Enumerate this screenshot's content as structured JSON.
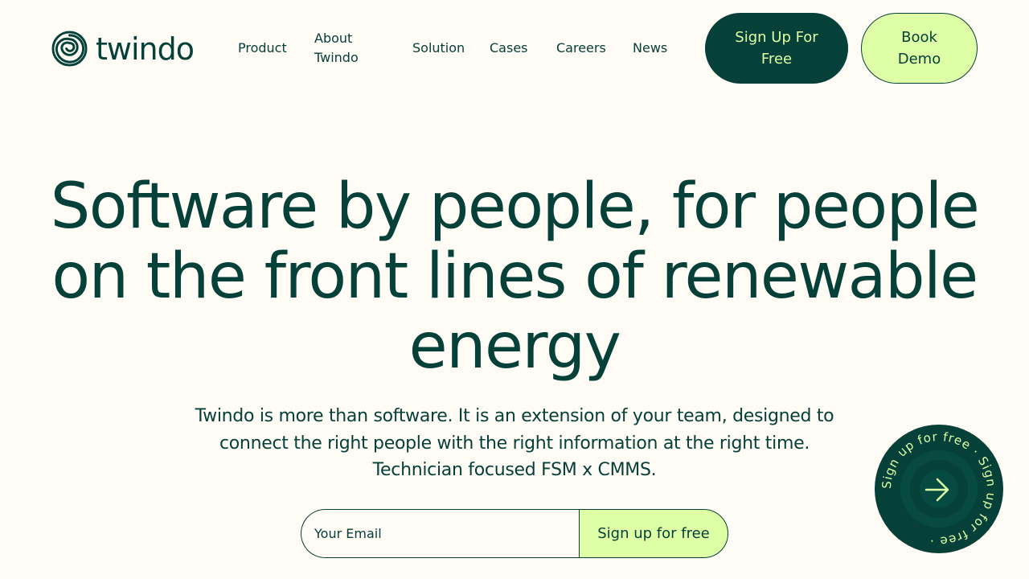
{
  "brand": {
    "name": "twindo",
    "logo_icon": "spiral-logo-icon"
  },
  "nav": {
    "items": [
      {
        "label": "Product"
      },
      {
        "label": "About\nTwindo"
      },
      {
        "label": "Solution"
      },
      {
        "label": "Cases"
      },
      {
        "label": "Careers"
      },
      {
        "label": "News"
      }
    ]
  },
  "header": {
    "signup_label": "Sign Up For Free",
    "demo_label": "Book Demo"
  },
  "hero": {
    "title": "Software by people, for people on the front lines of renewable energy",
    "subtitle": "Twindo is more than software. It is an extension of your team, designed to connect the right people with the right information at the right time. Technician focused FSM x CMMS."
  },
  "form": {
    "email_placeholder": "Your Email",
    "email_value": "",
    "submit_label": "Sign up for free"
  },
  "badge": {
    "ring_text": "Sign up for free · Sign up for free · ",
    "icon": "arrow-right-icon"
  },
  "colors": {
    "primary": "#054039",
    "accent": "#DFFFA6",
    "background": "#FFFBF5"
  }
}
